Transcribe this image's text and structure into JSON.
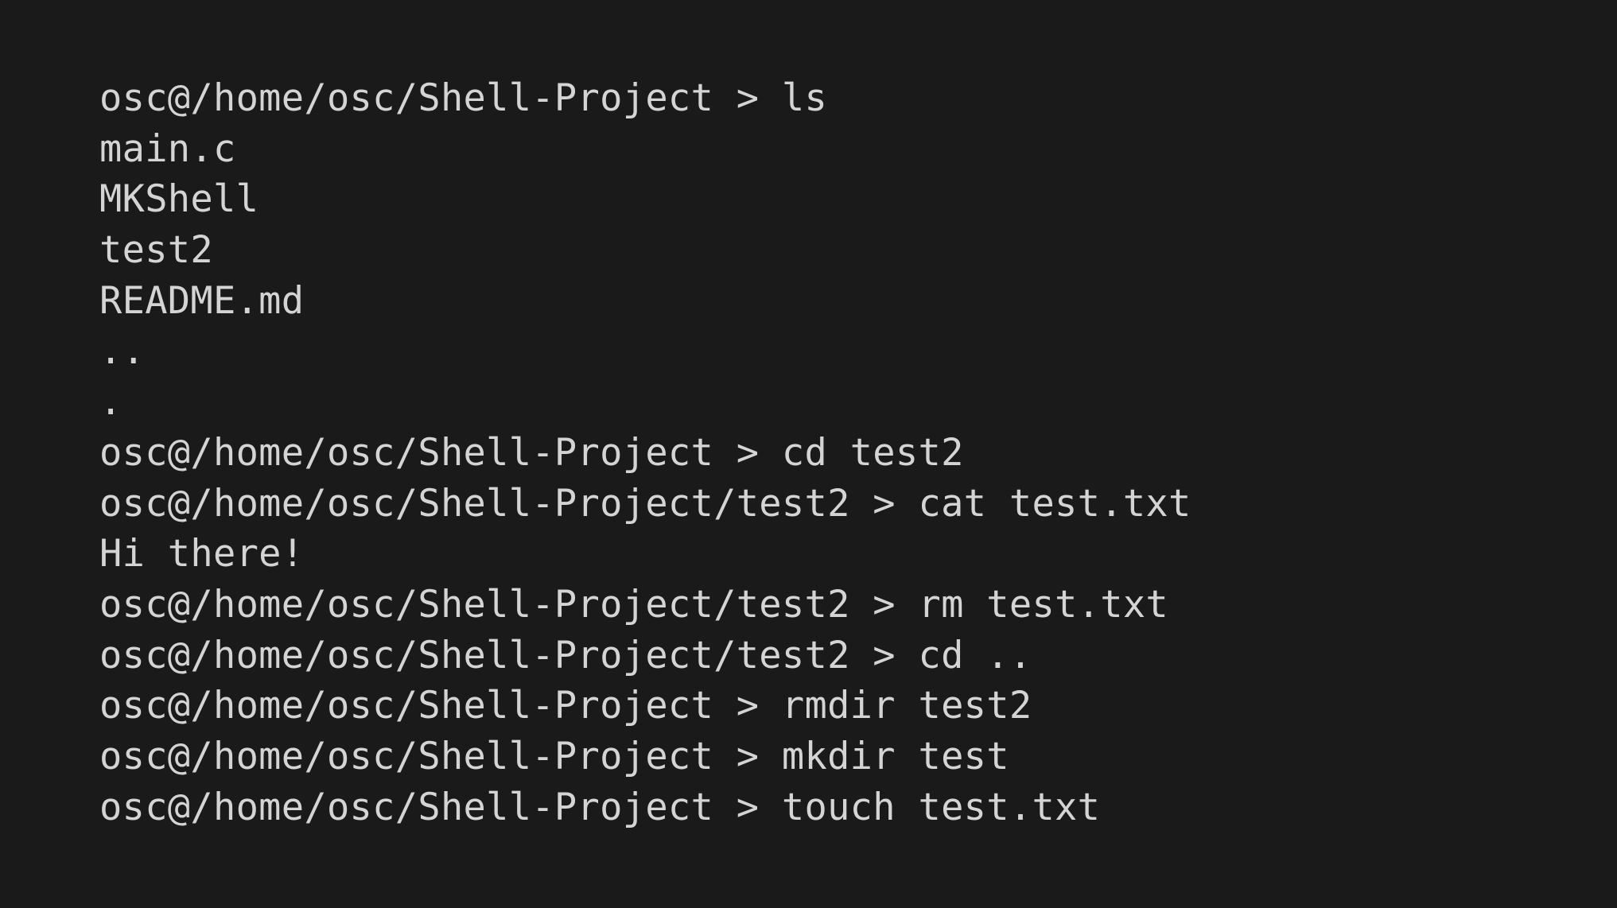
{
  "terminal": {
    "lines": [
      {
        "kind": "command",
        "text": "osc@/home/osc/Shell-Project > ls"
      },
      {
        "kind": "output",
        "text": "main.c"
      },
      {
        "kind": "output",
        "text": "MKShell"
      },
      {
        "kind": "output",
        "text": "test2"
      },
      {
        "kind": "output",
        "text": "README.md"
      },
      {
        "kind": "output",
        "text": ".."
      },
      {
        "kind": "output",
        "text": "."
      },
      {
        "kind": "command",
        "text": "osc@/home/osc/Shell-Project > cd test2"
      },
      {
        "kind": "command",
        "text": "osc@/home/osc/Shell-Project/test2 > cat test.txt"
      },
      {
        "kind": "output",
        "text": "Hi there!"
      },
      {
        "kind": "command",
        "text": "osc@/home/osc/Shell-Project/test2 > rm test.txt"
      },
      {
        "kind": "command",
        "text": "osc@/home/osc/Shell-Project/test2 > cd .."
      },
      {
        "kind": "command",
        "text": "osc@/home/osc/Shell-Project > rmdir test2"
      },
      {
        "kind": "command",
        "text": "osc@/home/osc/Shell-Project > mkdir test"
      },
      {
        "kind": "command",
        "text": "osc@/home/osc/Shell-Project > touch test.txt"
      }
    ]
  },
  "colors": {
    "background": "#1a1a1a",
    "text": "#d4d4d4"
  }
}
